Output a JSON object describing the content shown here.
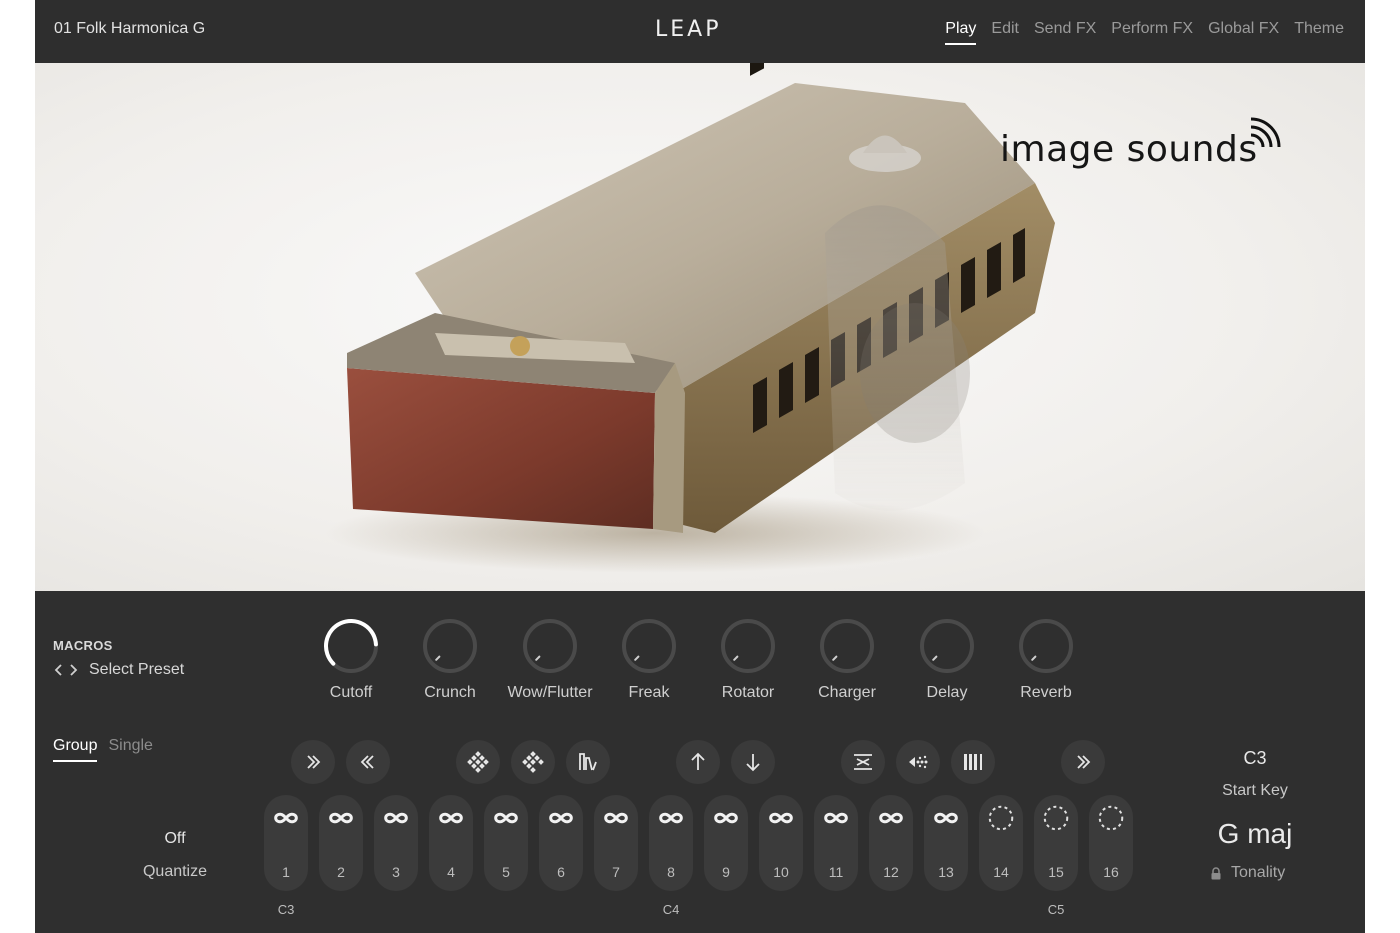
{
  "header": {
    "preset_name": "01 Folk Harmonica G",
    "logo": "LEAP",
    "tabs": [
      {
        "label": "Play",
        "active": true
      },
      {
        "label": "Edit",
        "active": false
      },
      {
        "label": "Send FX",
        "active": false
      },
      {
        "label": "Perform FX",
        "active": false
      },
      {
        "label": "Global FX",
        "active": false
      },
      {
        "label": "Theme",
        "active": false
      }
    ]
  },
  "artwork": {
    "brand": "image sounds",
    "brand_icon": "sound-waves-icon"
  },
  "macros": {
    "label": "MACROS",
    "select_preset": "Select Preset",
    "knobs": [
      {
        "label": "Cutoff",
        "value": 0.82
      },
      {
        "label": "Crunch",
        "value": 0
      },
      {
        "label": "Wow/Flutter",
        "value": 0
      },
      {
        "label": "Freak",
        "value": 0
      },
      {
        "label": "Rotator",
        "value": 0
      },
      {
        "label": "Charger",
        "value": 0
      },
      {
        "label": "Delay",
        "value": 0
      },
      {
        "label": "Reverb",
        "value": 0
      }
    ]
  },
  "mode": {
    "tabs": [
      {
        "label": "Group",
        "active": true
      },
      {
        "label": "Single",
        "active": false
      }
    ]
  },
  "quantize": {
    "value": "Off",
    "label": "Quantize"
  },
  "actions": [
    {
      "icon": "double-chevron-right-icon"
    },
    {
      "icon": "double-chevron-left-icon"
    },
    {
      "icon": "diamond-pattern-a-icon"
    },
    {
      "icon": "diamond-pattern-b-icon"
    },
    {
      "icon": "waveform-bars-icon"
    },
    {
      "icon": "arrow-up-icon"
    },
    {
      "icon": "arrow-down-icon"
    },
    {
      "icon": "compress-lines-icon"
    },
    {
      "icon": "reverse-dots-icon"
    },
    {
      "icon": "vertical-bars-icon"
    },
    {
      "icon": "double-chevron-right-icon"
    }
  ],
  "keys": [
    {
      "num": "1",
      "loop": true
    },
    {
      "num": "2",
      "loop": true
    },
    {
      "num": "3",
      "loop": true
    },
    {
      "num": "4",
      "loop": true
    },
    {
      "num": "5",
      "loop": true
    },
    {
      "num": "6",
      "loop": true
    },
    {
      "num": "7",
      "loop": true
    },
    {
      "num": "8",
      "loop": true
    },
    {
      "num": "9",
      "loop": true
    },
    {
      "num": "10",
      "loop": true
    },
    {
      "num": "11",
      "loop": true
    },
    {
      "num": "12",
      "loop": true
    },
    {
      "num": "13",
      "loop": true
    },
    {
      "num": "14",
      "loop": false
    },
    {
      "num": "15",
      "loop": false
    },
    {
      "num": "16",
      "loop": false
    }
  ],
  "octaves": [
    {
      "label": "C3",
      "key_index": 0
    },
    {
      "label": "C4",
      "key_index": 7
    },
    {
      "label": "C5",
      "key_index": 14
    }
  ],
  "start_key": {
    "value": "C3",
    "label": "Start Key"
  },
  "tonality": {
    "value": "G  maj",
    "label": "Tonality",
    "icon": "lock-icon"
  }
}
